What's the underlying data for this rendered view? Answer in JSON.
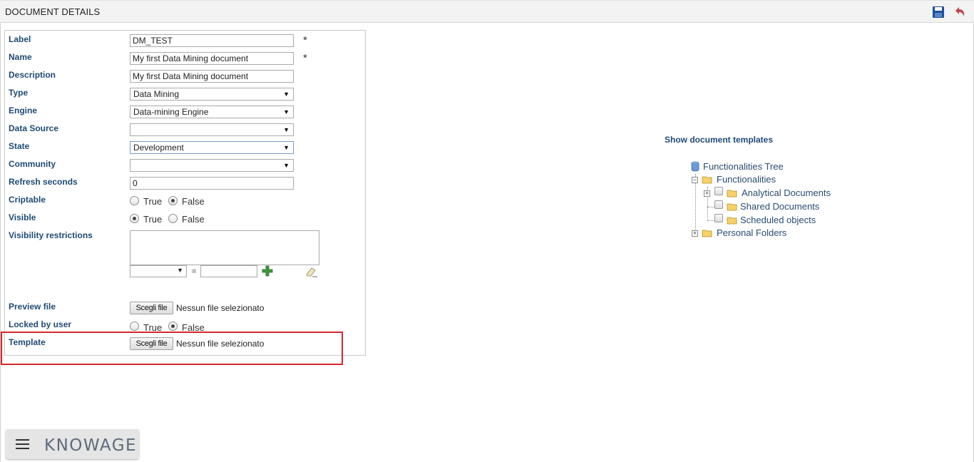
{
  "header": {
    "title": "DOCUMENT DETAILS"
  },
  "form": {
    "label": {
      "label": "Label",
      "value": "DM_TEST",
      "required": "*"
    },
    "name": {
      "label": "Name",
      "value": "My first Data Mining document",
      "required": "*"
    },
    "description": {
      "label": "Description",
      "value": "My first Data Mining document"
    },
    "type": {
      "label": "Type",
      "value": "Data Mining"
    },
    "engine": {
      "label": "Engine",
      "value": "Data-mining Engine"
    },
    "data_source": {
      "label": "Data Source",
      "value": ""
    },
    "state": {
      "label": "State",
      "value": "Development"
    },
    "community": {
      "label": "Community",
      "value": ""
    },
    "refresh_seconds": {
      "label": "Refresh seconds",
      "value": "0"
    },
    "criptable": {
      "label": "Criptable",
      "true_label": "True",
      "false_label": "False",
      "selected": "False"
    },
    "visible": {
      "label": "Visible",
      "true_label": "True",
      "false_label": "False",
      "selected": "True"
    },
    "visibility_restrictions": {
      "label": "Visibility restrictions",
      "equals": "="
    },
    "preview_file": {
      "label": "Preview file",
      "button": "Scegli file",
      "status": "Nessun file selezionato"
    },
    "locked_by_user": {
      "label": "Locked by user",
      "true_label": "True",
      "false_label": "False",
      "selected": "False"
    },
    "template": {
      "label": "Template",
      "button": "Scegli file",
      "status": "Nessun file selezionato"
    }
  },
  "templates_panel": {
    "title": "Show document templates",
    "tree": {
      "root": "Functionalities Tree",
      "functionalities": "Functionalities",
      "analytical": "Analytical Documents",
      "shared": "Shared Documents",
      "scheduled": "Scheduled objects",
      "personal": "Personal Folders"
    }
  },
  "footer": {
    "brand": "KNOWAGE"
  },
  "colors": {
    "label_blue": "#1f4a75",
    "highlight_red": "#d7262e",
    "folder_yellow": "#f7d26a"
  }
}
